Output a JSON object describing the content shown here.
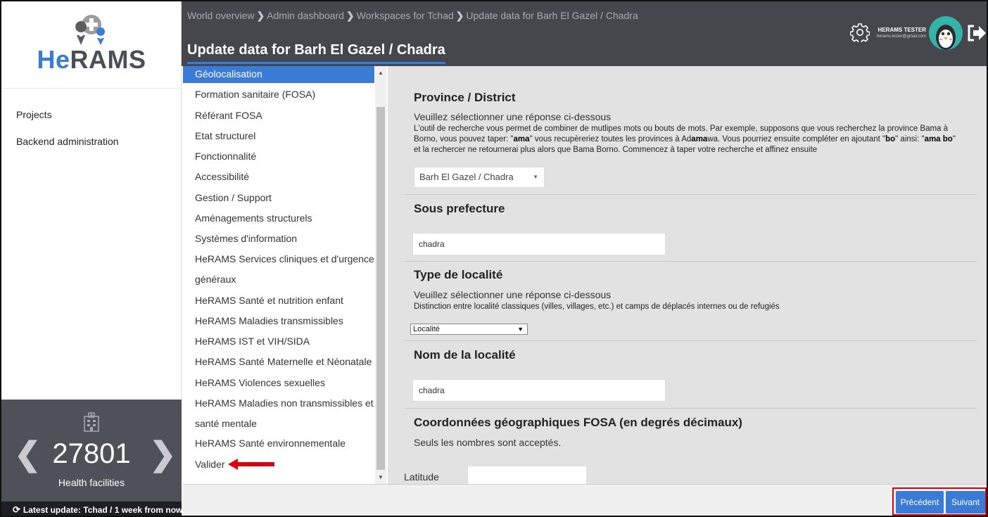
{
  "sidebar": {
    "logo": "HeRAMS",
    "nav": [
      "Projects",
      "Backend administration"
    ],
    "stats": {
      "count": "27801",
      "caption": "Health facilities"
    },
    "last_update": "Latest update: Tchad / 1 week from now"
  },
  "header": {
    "breadcrumb": [
      "World overview",
      "Admin dashboard",
      "Workspaces for Tchad",
      "Update data for Barh El Gazel / Chadra"
    ],
    "title": "Update data for Barh El Gazel / Chadra",
    "user": {
      "name": "HERAMS TESTER",
      "email": "herams.tester@gmail.com"
    }
  },
  "sections": [
    "Géolocalisation",
    "Formation sanitaire (FOSA)",
    "Référant FOSA",
    "Etat structurel",
    "Fonctionnalité",
    "Accessibilité",
    "Gestion / Support",
    "Aménagements structurels",
    "Systèmes d'information",
    "HeRAMS Services cliniques et d'urgence",
    "généraux",
    "HeRAMS Santé et nutrition enfant",
    "HeRAMS Maladies transmissibles",
    "HeRAMS IST et VIH/SIDA",
    "HeRAMS Santé Maternelle et Néonatale",
    "HeRAMS Violences sexuelles",
    "HeRAMS Maladies non transmissibles et",
    "santé mentale",
    "HeRAMS Santé environnementale",
    "Valider"
  ],
  "form": {
    "q1": {
      "title": "Province / District",
      "desc": "Veuillez sélectionner une réponse ci-dessous",
      "help": {
        "l1": "L'outil de recherche vous permet de combiner de mutlipes mots ou bouts de mots. Par exemple, supposons que vous recherchez la province Bama à",
        "l2a": "Borno, vous pouvez taper: \"",
        "l2b": "ama",
        "l2c": "\" vous recupèreriez toutes les provinces  à Ad",
        "l2d": "ama",
        "l2e": "wa. Vous pourriez ensuite compléter en ajoutant \"",
        "l2f": "bo",
        "l2g": "\" ainsi: \"",
        "l2h": "ama bo",
        "l2i": "\"",
        "l3": "et la rechercer ne retournerai plus alors que Bama Borno. Commencez à taper votre recherche et affinez ensuite"
      },
      "value": "Barh El Gazel / Chadra"
    },
    "q2": {
      "title": "Sous prefecture",
      "value": "chadra"
    },
    "q3": {
      "title": "Type de localité",
      "desc": "Veuillez sélectionner une réponse ci-dessous",
      "help": "Distinction entre localité classiques (villes, villages, etc.) et camps de déplacés internes ou de refugiés",
      "value": "Localité"
    },
    "q4": {
      "title": "Nom de la localité",
      "value": "chadra"
    },
    "q5": {
      "title": "Coordonnées géographiques FOSA (en degrés décimaux)",
      "desc": "Seuls les nombres sont acceptés.",
      "lat_label": "Latitude"
    }
  },
  "footer": {
    "prev": "Précédent",
    "next": "Suivant"
  },
  "colors": {
    "accent": "#3a7bd5",
    "header": "#45474d",
    "highlight": "#e0000d"
  }
}
